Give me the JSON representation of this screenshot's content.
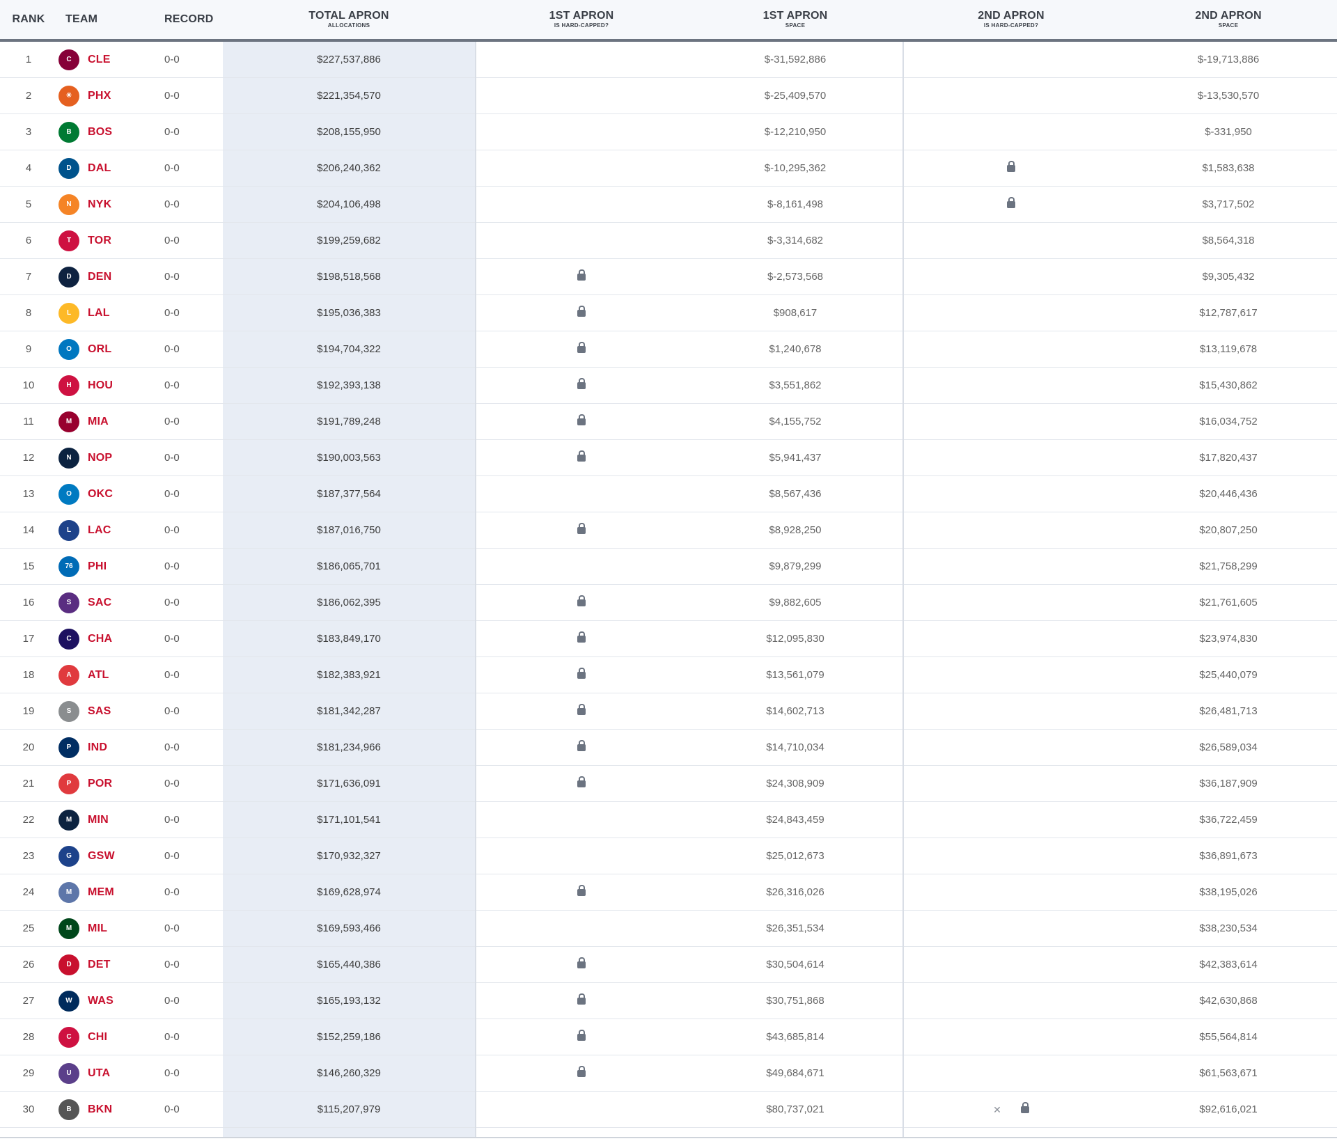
{
  "headers": {
    "rank": "RANK",
    "team": "TEAM",
    "record": "RECORD",
    "total_main": "TOTAL APRON",
    "total_sub": "ALLOCATIONS",
    "apron1_hc_main": "1ST APRON",
    "apron1_hc_sub": "IS HARD-CAPPED?",
    "apron1_space_main": "1ST APRON",
    "apron1_space_sub": "SPACE",
    "apron2_hc_main": "2ND APRON",
    "apron2_hc_sub": "IS HARD-CAPPED?",
    "apron2_space_main": "2ND APRON",
    "apron2_space_sub": "SPACE"
  },
  "colors": {
    "team_abbr": "#c8102e",
    "shaded_column": "#e8edf5",
    "lock": "#6b7380"
  },
  "rows": [
    {
      "rank": "1",
      "abbr": "CLE",
      "logo_color": "#860038",
      "logo_text": "C",
      "record": "0-0",
      "total": "$227,537,886",
      "apron1_locked": false,
      "apron1_space": "$-31,592,886",
      "apron2_locked": false,
      "apron2_x": false,
      "apron2_space": "$-19,713,886"
    },
    {
      "rank": "2",
      "abbr": "PHX",
      "logo_color": "#e56020",
      "logo_text": "☀",
      "record": "0-0",
      "total": "$221,354,570",
      "apron1_locked": false,
      "apron1_space": "$-25,409,570",
      "apron2_locked": false,
      "apron2_x": false,
      "apron2_space": "$-13,530,570"
    },
    {
      "rank": "3",
      "abbr": "BOS",
      "logo_color": "#007a33",
      "logo_text": "B",
      "record": "0-0",
      "total": "$208,155,950",
      "apron1_locked": false,
      "apron1_space": "$-12,210,950",
      "apron2_locked": false,
      "apron2_x": false,
      "apron2_space": "$-331,950"
    },
    {
      "rank": "4",
      "abbr": "DAL",
      "logo_color": "#00538c",
      "logo_text": "D",
      "record": "0-0",
      "total": "$206,240,362",
      "apron1_locked": false,
      "apron1_space": "$-10,295,362",
      "apron2_locked": true,
      "apron2_x": false,
      "apron2_space": "$1,583,638"
    },
    {
      "rank": "5",
      "abbr": "NYK",
      "logo_color": "#f58426",
      "logo_text": "N",
      "record": "0-0",
      "total": "$204,106,498",
      "apron1_locked": false,
      "apron1_space": "$-8,161,498",
      "apron2_locked": true,
      "apron2_x": false,
      "apron2_space": "$3,717,502"
    },
    {
      "rank": "6",
      "abbr": "TOR",
      "logo_color": "#ce1141",
      "logo_text": "T",
      "record": "0-0",
      "total": "$199,259,682",
      "apron1_locked": false,
      "apron1_space": "$-3,314,682",
      "apron2_locked": false,
      "apron2_x": false,
      "apron2_space": "$8,564,318"
    },
    {
      "rank": "7",
      "abbr": "DEN",
      "logo_color": "#0e2240",
      "logo_text": "D",
      "record": "0-0",
      "total": "$198,518,568",
      "apron1_locked": true,
      "apron1_space": "$-2,573,568",
      "apron2_locked": false,
      "apron2_x": false,
      "apron2_space": "$9,305,432"
    },
    {
      "rank": "8",
      "abbr": "LAL",
      "logo_color": "#fdb927",
      "logo_text": "L",
      "record": "0-0",
      "total": "$195,036,383",
      "apron1_locked": true,
      "apron1_space": "$908,617",
      "apron2_locked": false,
      "apron2_x": false,
      "apron2_space": "$12,787,617"
    },
    {
      "rank": "9",
      "abbr": "ORL",
      "logo_color": "#0077c0",
      "logo_text": "O",
      "record": "0-0",
      "total": "$194,704,322",
      "apron1_locked": true,
      "apron1_space": "$1,240,678",
      "apron2_locked": false,
      "apron2_x": false,
      "apron2_space": "$13,119,678"
    },
    {
      "rank": "10",
      "abbr": "HOU",
      "logo_color": "#ce1141",
      "logo_text": "H",
      "record": "0-0",
      "total": "$192,393,138",
      "apron1_locked": true,
      "apron1_space": "$3,551,862",
      "apron2_locked": false,
      "apron2_x": false,
      "apron2_space": "$15,430,862"
    },
    {
      "rank": "11",
      "abbr": "MIA",
      "logo_color": "#98002e",
      "logo_text": "M",
      "record": "0-0",
      "total": "$191,789,248",
      "apron1_locked": true,
      "apron1_space": "$4,155,752",
      "apron2_locked": false,
      "apron2_x": false,
      "apron2_space": "$16,034,752"
    },
    {
      "rank": "12",
      "abbr": "NOP",
      "logo_color": "#0c2340",
      "logo_text": "N",
      "record": "0-0",
      "total": "$190,003,563",
      "apron1_locked": true,
      "apron1_space": "$5,941,437",
      "apron2_locked": false,
      "apron2_x": false,
      "apron2_space": "$17,820,437"
    },
    {
      "rank": "13",
      "abbr": "OKC",
      "logo_color": "#007ac1",
      "logo_text": "O",
      "record": "0-0",
      "total": "$187,377,564",
      "apron1_locked": false,
      "apron1_space": "$8,567,436",
      "apron2_locked": false,
      "apron2_x": false,
      "apron2_space": "$20,446,436"
    },
    {
      "rank": "14",
      "abbr": "LAC",
      "logo_color": "#1d428a",
      "logo_text": "L",
      "record": "0-0",
      "total": "$187,016,750",
      "apron1_locked": true,
      "apron1_space": "$8,928,250",
      "apron2_locked": false,
      "apron2_x": false,
      "apron2_space": "$20,807,250"
    },
    {
      "rank": "15",
      "abbr": "PHI",
      "logo_color": "#006bb6",
      "logo_text": "76",
      "record": "0-0",
      "total": "$186,065,701",
      "apron1_locked": false,
      "apron1_space": "$9,879,299",
      "apron2_locked": false,
      "apron2_x": false,
      "apron2_space": "$21,758,299"
    },
    {
      "rank": "16",
      "abbr": "SAC",
      "logo_color": "#5a2d81",
      "logo_text": "S",
      "record": "0-0",
      "total": "$186,062,395",
      "apron1_locked": true,
      "apron1_space": "$9,882,605",
      "apron2_locked": false,
      "apron2_x": false,
      "apron2_space": "$21,761,605"
    },
    {
      "rank": "17",
      "abbr": "CHA",
      "logo_color": "#1d1160",
      "logo_text": "C",
      "record": "0-0",
      "total": "$183,849,170",
      "apron1_locked": true,
      "apron1_space": "$12,095,830",
      "apron2_locked": false,
      "apron2_x": false,
      "apron2_space": "$23,974,830"
    },
    {
      "rank": "18",
      "abbr": "ATL",
      "logo_color": "#e03a3e",
      "logo_text": "A",
      "record": "0-0",
      "total": "$182,383,921",
      "apron1_locked": true,
      "apron1_space": "$13,561,079",
      "apron2_locked": false,
      "apron2_x": false,
      "apron2_space": "$25,440,079"
    },
    {
      "rank": "19",
      "abbr": "SAS",
      "logo_color": "#8a8d8f",
      "logo_text": "S",
      "record": "0-0",
      "total": "$181,342,287",
      "apron1_locked": true,
      "apron1_space": "$14,602,713",
      "apron2_locked": false,
      "apron2_x": false,
      "apron2_space": "$26,481,713"
    },
    {
      "rank": "20",
      "abbr": "IND",
      "logo_color": "#002d62",
      "logo_text": "P",
      "record": "0-0",
      "total": "$181,234,966",
      "apron1_locked": true,
      "apron1_space": "$14,710,034",
      "apron2_locked": false,
      "apron2_x": false,
      "apron2_space": "$26,589,034"
    },
    {
      "rank": "21",
      "abbr": "POR",
      "logo_color": "#e03a3e",
      "logo_text": "P",
      "record": "0-0",
      "total": "$171,636,091",
      "apron1_locked": true,
      "apron1_space": "$24,308,909",
      "apron2_locked": false,
      "apron2_x": false,
      "apron2_space": "$36,187,909"
    },
    {
      "rank": "22",
      "abbr": "MIN",
      "logo_color": "#0c2340",
      "logo_text": "M",
      "record": "0-0",
      "total": "$171,101,541",
      "apron1_locked": false,
      "apron1_space": "$24,843,459",
      "apron2_locked": false,
      "apron2_x": false,
      "apron2_space": "$36,722,459"
    },
    {
      "rank": "23",
      "abbr": "GSW",
      "logo_color": "#1d428a",
      "logo_text": "G",
      "record": "0-0",
      "total": "$170,932,327",
      "apron1_locked": false,
      "apron1_space": "$25,012,673",
      "apron2_locked": false,
      "apron2_x": false,
      "apron2_space": "$36,891,673"
    },
    {
      "rank": "24",
      "abbr": "MEM",
      "logo_color": "#5d76a9",
      "logo_text": "M",
      "record": "0-0",
      "total": "$169,628,974",
      "apron1_locked": true,
      "apron1_space": "$26,316,026",
      "apron2_locked": false,
      "apron2_x": false,
      "apron2_space": "$38,195,026"
    },
    {
      "rank": "25",
      "abbr": "MIL",
      "logo_color": "#00471b",
      "logo_text": "M",
      "record": "0-0",
      "total": "$169,593,466",
      "apron1_locked": false,
      "apron1_space": "$26,351,534",
      "apron2_locked": false,
      "apron2_x": false,
      "apron2_space": "$38,230,534"
    },
    {
      "rank": "26",
      "abbr": "DET",
      "logo_color": "#c8102e",
      "logo_text": "D",
      "record": "0-0",
      "total": "$165,440,386",
      "apron1_locked": true,
      "apron1_space": "$30,504,614",
      "apron2_locked": false,
      "apron2_x": false,
      "apron2_space": "$42,383,614"
    },
    {
      "rank": "27",
      "abbr": "WAS",
      "logo_color": "#002b5c",
      "logo_text": "W",
      "record": "0-0",
      "total": "$165,193,132",
      "apron1_locked": true,
      "apron1_space": "$30,751,868",
      "apron2_locked": false,
      "apron2_x": false,
      "apron2_space": "$42,630,868"
    },
    {
      "rank": "28",
      "abbr": "CHI",
      "logo_color": "#ce1141",
      "logo_text": "C",
      "record": "0-0",
      "total": "$152,259,186",
      "apron1_locked": true,
      "apron1_space": "$43,685,814",
      "apron2_locked": false,
      "apron2_x": false,
      "apron2_space": "$55,564,814"
    },
    {
      "rank": "29",
      "abbr": "UTA",
      "logo_color": "#5b3f8a",
      "logo_text": "U",
      "record": "0-0",
      "total": "$146,260,329",
      "apron1_locked": true,
      "apron1_space": "$49,684,671",
      "apron2_locked": false,
      "apron2_x": false,
      "apron2_space": "$61,563,671"
    },
    {
      "rank": "30",
      "abbr": "BKN",
      "logo_color": "#555555",
      "logo_text": "B",
      "record": "0-0",
      "total": "$115,207,979",
      "apron1_locked": false,
      "apron1_space": "$80,737,021",
      "apron2_locked": true,
      "apron2_x": true,
      "apron2_space": "$92,616,021"
    }
  ]
}
